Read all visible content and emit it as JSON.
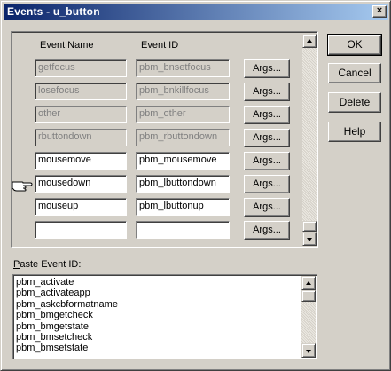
{
  "window": {
    "title": "Events - u_button",
    "close_glyph": "×"
  },
  "columns": {
    "event_name": "Event Name",
    "event_id": "Event ID"
  },
  "rows": [
    {
      "name": "getfocus",
      "id": "pbm_bnsetfocus",
      "enabled": false,
      "args_label": "Args..."
    },
    {
      "name": "losefocus",
      "id": "pbm_bnkillfocus",
      "enabled": false,
      "args_label": "Args..."
    },
    {
      "name": "other",
      "id": "pbm_other",
      "enabled": false,
      "args_label": "Args..."
    },
    {
      "name": "rbuttondown",
      "id": "pbm_rbuttondown",
      "enabled": false,
      "args_label": "Args..."
    },
    {
      "name": "mousemove",
      "id": "pbm_mousemove",
      "enabled": true,
      "args_label": "Args..."
    },
    {
      "name": "mousedown",
      "id": "pbm_lbuttondown",
      "enabled": true,
      "args_label": "Args..."
    },
    {
      "name": "mouseup",
      "id": "pbm_lbuttonup",
      "enabled": true,
      "args_label": "Args..."
    },
    {
      "name": "",
      "id": "",
      "enabled": true,
      "args_label": "Args..."
    }
  ],
  "current_row_indicator": "pointing-hand-icon",
  "buttons": {
    "ok": "OK",
    "cancel": "Cancel",
    "delete": "Delete",
    "help": "Help"
  },
  "paste": {
    "label_prefix": "P",
    "label_rest": "aste Event ID:",
    "items": [
      "pbm_activate",
      "pbm_activateapp",
      "pbm_askcbformatname",
      "pbm_bmgetcheck",
      "pbm_bmgetstate",
      "pbm_bmsetcheck",
      "pbm_bmsetstate"
    ]
  },
  "colors": {
    "titlebar_start": "#0a246a",
    "titlebar_end": "#a6caf0",
    "face": "#d4d0c8"
  }
}
